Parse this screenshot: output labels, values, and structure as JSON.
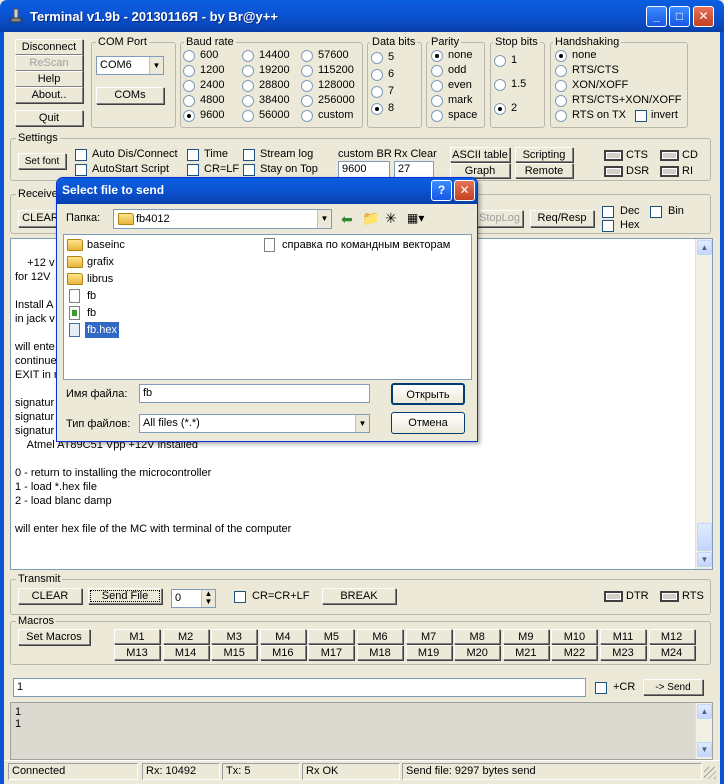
{
  "window": {
    "title": "Terminal v1.9b - 20130116Я - by Br@y++"
  },
  "buttons_left": {
    "disconnect": "Disconnect",
    "rescan": "ReScan",
    "help": "Help",
    "about": "About..",
    "quit": "Quit"
  },
  "com_port": {
    "label": "COM Port",
    "value": "COM6",
    "coms_button": "COMs"
  },
  "baud_rate": {
    "label": "Baud rate",
    "options": [
      "600",
      "1200",
      "2400",
      "4800",
      "9600",
      "14400",
      "19200",
      "28800",
      "38400",
      "56000",
      "57600",
      "115200",
      "128000",
      "256000",
      "custom"
    ],
    "selected": "9600"
  },
  "data_bits": {
    "label": "Data bits",
    "options": [
      "5",
      "6",
      "7",
      "8"
    ],
    "selected": "8"
  },
  "parity": {
    "label": "Parity",
    "options": [
      "none",
      "odd",
      "even",
      "mark",
      "space"
    ],
    "selected": "none"
  },
  "stop_bits": {
    "label": "Stop bits",
    "options": [
      "1",
      "1.5",
      "2"
    ],
    "selected": "2"
  },
  "handshaking": {
    "label": "Handshaking",
    "options": [
      "none",
      "RTS/CTS",
      "XON/XOFF",
      "RTS/CTS+XON/XOFF",
      "RTS on TX"
    ],
    "selected": "none",
    "invert": "invert"
  },
  "settings": {
    "label": "Settings",
    "set_font": "Set font",
    "auto_dis": "Auto Dis/Connect",
    "autostart": "AutoStart Script",
    "time": "Time",
    "crlf": "CR=LF",
    "stream_log": "Stream log",
    "stay_on_top": "Stay on Top",
    "custom_br_label": "custom BR",
    "custom_br_value": "9600",
    "rx_clear_label": "Rx Clear",
    "rx_clear_value": "27",
    "ascii_table": "ASCII table",
    "graph": "Graph",
    "scripting": "Scripting",
    "remote": "Remote",
    "leds": [
      "CTS",
      "CD",
      "DSR",
      "RI"
    ]
  },
  "receive": {
    "label": "Receive",
    "clear": "CLEAR",
    "stoplog": "StopLog",
    "reqresp": "Req/Resp",
    "dec": "Dec",
    "hex": "Hex",
    "bin": "Bin"
  },
  "log_lines": [
    "",
    "    +12 v",
    "for 12V",
    "",
    "Install A",
    "in jack v",
    "",
    "will ente",
    "continue",
    "EXIT in r",
    "",
    "signatur",
    "signatur",
    "signatur",
    "    Atmel AT89C51 Vpp +12V installed",
    "",
    "0 - return to installing the microcontroller",
    "1 - load *.hex file",
    "2 - load blanc damp",
    "",
    "will enter hex file of the MC with terminal of the computer"
  ],
  "transmit": {
    "label": "Transmit",
    "clear": "CLEAR",
    "send_file": "Send File",
    "counter": "0",
    "crcrlf": "CR=CR+LF",
    "break": "BREAK",
    "dtr": "DTR",
    "rts": "RTS"
  },
  "macros": {
    "label": "Macros",
    "set_macros": "Set Macros",
    "row1": [
      "M1",
      "M2",
      "M3",
      "M4",
      "M5",
      "M6",
      "M7",
      "M8",
      "M9",
      "M10",
      "M11",
      "M12"
    ],
    "row2": [
      "M13",
      "M14",
      "M15",
      "M16",
      "M17",
      "M18",
      "M19",
      "M20",
      "M21",
      "M22",
      "M23",
      "M24"
    ]
  },
  "send": {
    "input_value": "1",
    "plus_cr": "+CR",
    "send_button": "-> Send"
  },
  "transmit_log": [
    "1",
    "1"
  ],
  "statusbar": {
    "connected": "Connected",
    "rx": "Rx: 10492",
    "tx": "Tx: 5",
    "rxok": "Rx OK",
    "sendfile": "Send file: 9297 bytes send"
  },
  "dialog": {
    "title": "Select file to send",
    "folder_label": "Папка:",
    "folder_value": "fb4012",
    "files": [
      {
        "name": "baseinc",
        "kind": "folder"
      },
      {
        "name": "grafix",
        "kind": "folder"
      },
      {
        "name": "librus",
        "kind": "folder"
      },
      {
        "name": "fb",
        "kind": "file"
      },
      {
        "name": "fb",
        "kind": "exe"
      },
      {
        "name": "fb.hex",
        "kind": "hex"
      }
    ],
    "files_col2": [
      {
        "name": "справка по командным векторам",
        "kind": "doc"
      }
    ],
    "filename_label": "Имя файла:",
    "filename_value": "fb",
    "filetype_label": "Тип файлов:",
    "filetype_value": "All files (*.*)",
    "open_button": "Открыть",
    "cancel_button": "Отмена"
  },
  "colors": {
    "titlebar": "#0b55d4",
    "face": "#ece9d8",
    "selection": "#316ac5"
  }
}
